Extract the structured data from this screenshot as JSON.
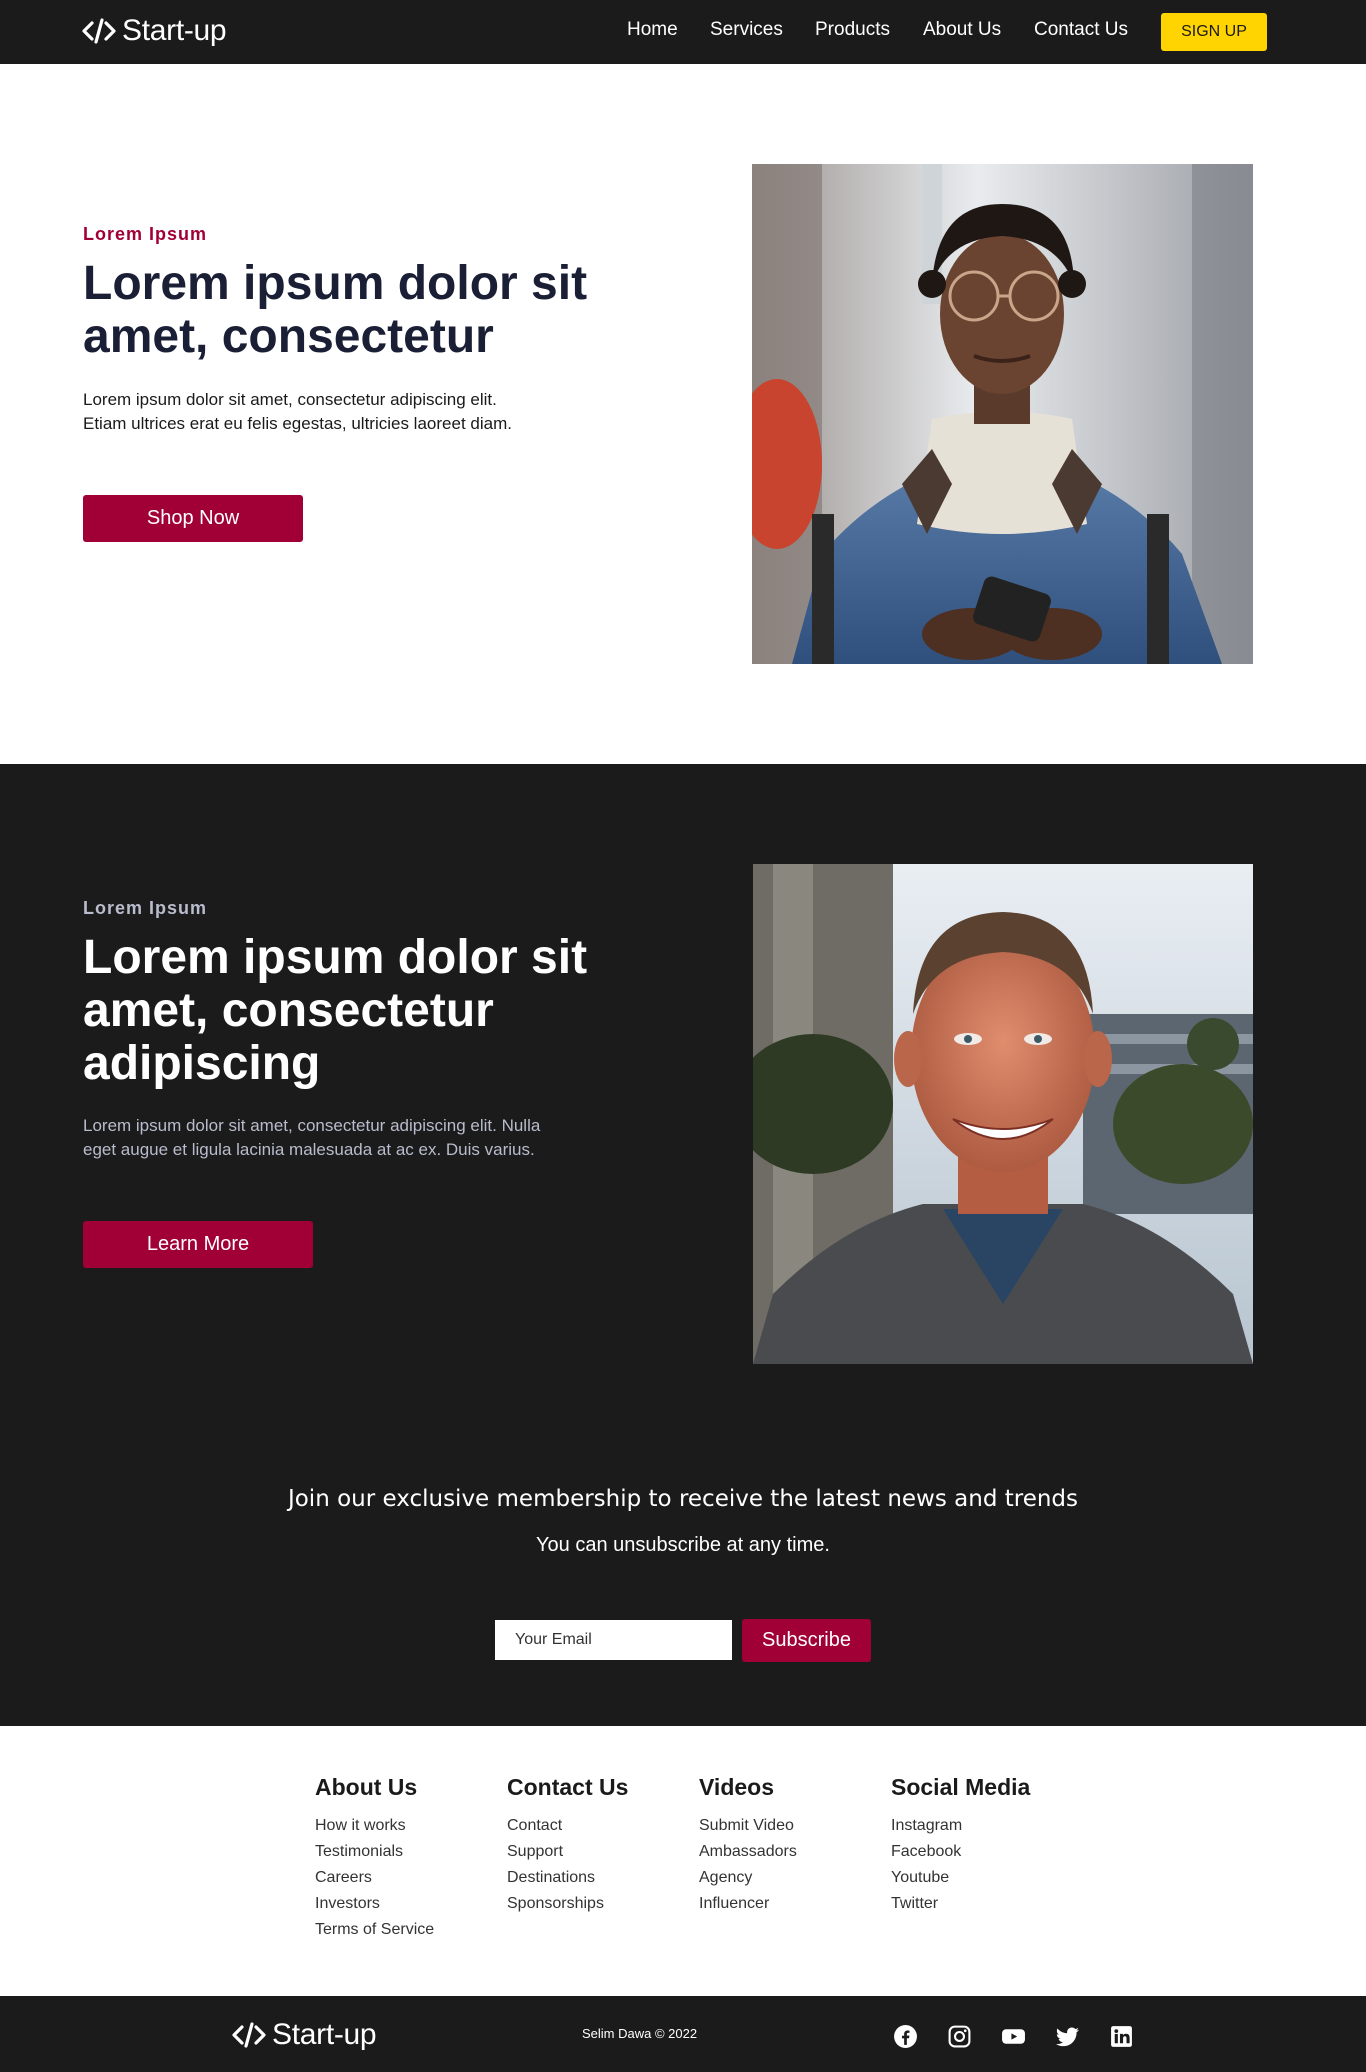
{
  "nav": {
    "brand": "Start-up",
    "links": [
      "Home",
      "Services",
      "Products",
      "About Us",
      "Contact Us"
    ],
    "signup": "SIGN UP"
  },
  "hero1": {
    "eyebrow": "Lorem Ipsum",
    "headline": "Lorem ipsum dolor sit amet, consectetur",
    "paragraph": "Lorem ipsum dolor sit amet, consectetur adipiscing elit. Etiam ultrices erat eu felis egestas, ultricies laoreet diam.",
    "button": "Shop Now"
  },
  "hero2": {
    "eyebrow": "Lorem Ipsum",
    "headline": "Lorem ipsum dolor sit amet, consectetur adipiscing",
    "paragraph": "Lorem ipsum dolor sit amet, consectetur adipiscing elit. Nulla eget augue et ligula lacinia malesuada at ac ex. Duis varius.",
    "button": "Learn More"
  },
  "newsletter": {
    "title": "Join our exclusive membership to receive the latest news and trends",
    "subtitle": "You can unsubscribe at any time.",
    "email_placeholder": "Your Email",
    "button": "Subscribe"
  },
  "footer": {
    "columns": [
      {
        "title": "About Us",
        "links": [
          "How it works",
          "Testimonials",
          "Careers",
          "Investors",
          "Terms of Service"
        ]
      },
      {
        "title": "Contact Us",
        "links": [
          "Contact",
          "Support",
          "Destinations",
          "Sponsorships"
        ]
      },
      {
        "title": "Videos",
        "links": [
          "Submit Video",
          "Ambassadors",
          "Agency",
          "Influencer"
        ]
      },
      {
        "title": "Social Media",
        "links": [
          "Instagram",
          "Facebook",
          "Youtube",
          "Twitter"
        ]
      }
    ],
    "brand": "Start-up",
    "copyright": "Selim Dawa © 2022",
    "social_icons": [
      "facebook-icon",
      "instagram-icon",
      "youtube-icon",
      "twitter-icon",
      "linkedin-icon"
    ]
  },
  "colors": {
    "dark": "#1b1b1b",
    "accent": "#a10037",
    "signup": "#ffd400",
    "heading_dark": "#1a1f36",
    "muted_text": "#b8bccc"
  }
}
